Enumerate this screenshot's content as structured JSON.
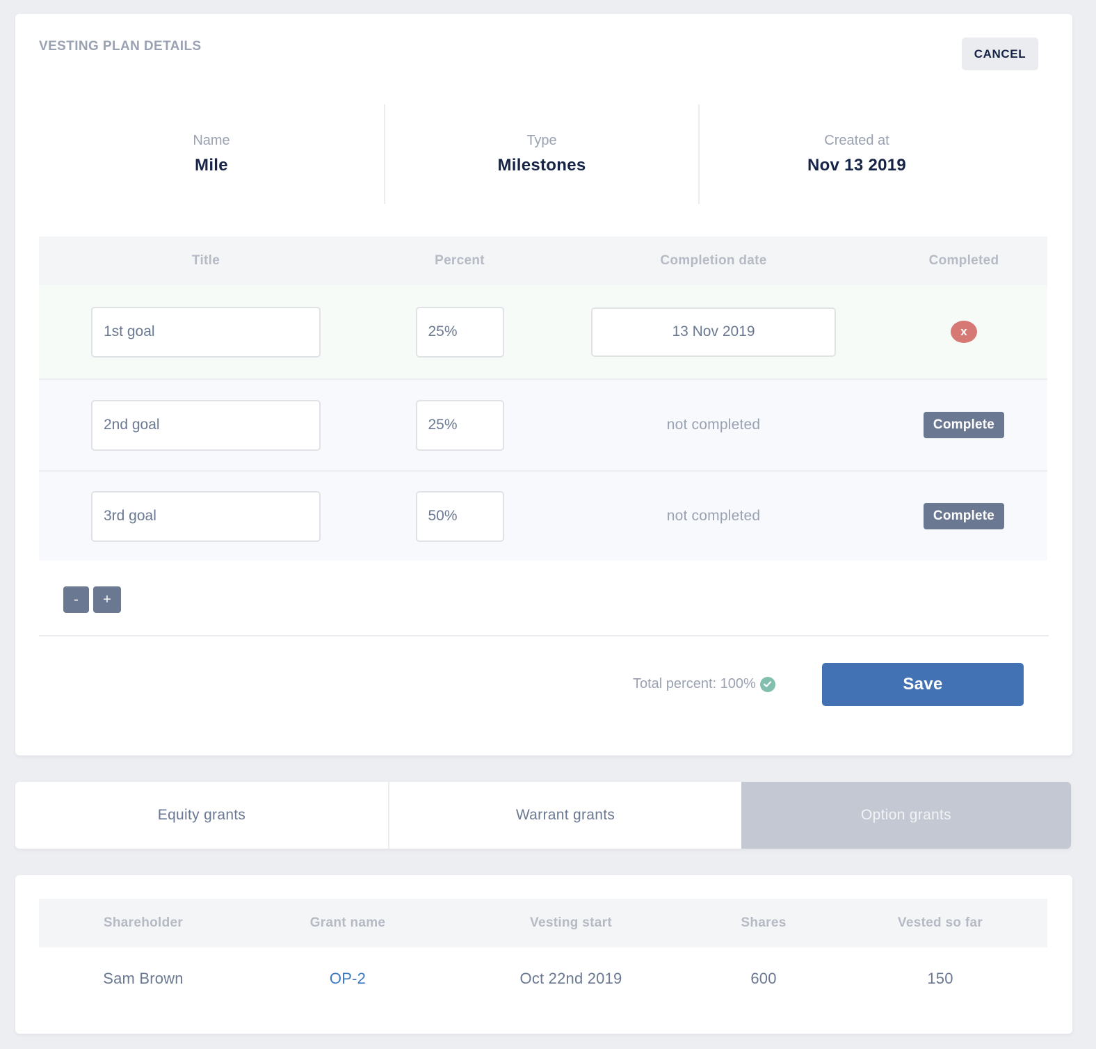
{
  "plan": {
    "section_title": "VESTING PLAN DETAILS",
    "cancel_label": "CANCEL",
    "summary": {
      "name_label": "Name",
      "name_value": "Mile",
      "type_label": "Type",
      "type_value": "Milestones",
      "created_label": "Created at",
      "created_value": "Nov 13 2019"
    },
    "milestones": {
      "headers": {
        "title": "Title",
        "percent": "Percent",
        "completion_date": "Completion date",
        "completed": "Completed"
      },
      "rows": [
        {
          "title": "1st goal",
          "percent": "25%",
          "completion_date": "13 Nov 2019",
          "completed": true,
          "action_label": "x"
        },
        {
          "title": "2nd goal",
          "percent": "25%",
          "completion_date": "not completed",
          "completed": false,
          "action_label": "Complete"
        },
        {
          "title": "3rd goal",
          "percent": "50%",
          "completion_date": "not completed",
          "completed": false,
          "action_label": "Complete"
        }
      ]
    },
    "remove_row_label": "-",
    "add_row_label": "+",
    "total_percent_text": "Total percent: 100%",
    "total_valid_icon": "check-circle-icon",
    "save_label": "Save"
  },
  "tabs": {
    "items": [
      {
        "label": "Equity grants",
        "active": false
      },
      {
        "label": "Warrant grants",
        "active": false
      },
      {
        "label": "Option grants",
        "active": true
      }
    ]
  },
  "grants": {
    "headers": {
      "shareholder": "Shareholder",
      "grant_name": "Grant name",
      "vesting_start": "Vesting start",
      "shares": "Shares",
      "vested_so_far": "Vested so far"
    },
    "rows": [
      {
        "shareholder": "Sam Brown",
        "grant_name": "OP-2",
        "vesting_start": "Oct 22nd 2019",
        "shares": "600",
        "vested_so_far": "150"
      }
    ]
  },
  "colors": {
    "accent": "#4272b4",
    "secondary_button": "#6b7891",
    "danger": "#d67873",
    "success": "#82bfae",
    "link": "#3a78c2"
  }
}
